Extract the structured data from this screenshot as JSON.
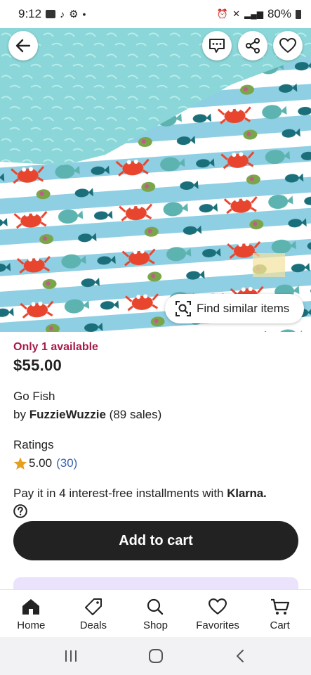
{
  "status": {
    "time": "9:12",
    "battery": "80%"
  },
  "product": {
    "availability": "Only 1 available",
    "price": "$55.00",
    "title": "Go Fish",
    "seller_prefix": "by ",
    "seller": "FuzzieWuzzie",
    "sales": " (89 sales)"
  },
  "find_similar": "Find similar items",
  "ratings": {
    "label": "Ratings",
    "score": "5.00",
    "count": "(30)"
  },
  "klarna": {
    "text": "Pay it in 4 interest-free installments with ",
    "brand": "Klarna."
  },
  "add_to_cart": "Add to cart",
  "tabs": [
    {
      "label": "Home",
      "icon": "home-icon"
    },
    {
      "label": "Deals",
      "icon": "tag-icon"
    },
    {
      "label": "Shop",
      "icon": "search-icon"
    },
    {
      "label": "Favorites",
      "icon": "heart-icon"
    },
    {
      "label": "Cart",
      "icon": "cart-icon"
    }
  ],
  "colors": {
    "accent_availability": "#a61a4a",
    "rating_count": "#3b65b0",
    "button": "#222222",
    "star": "#e6a01e"
  }
}
